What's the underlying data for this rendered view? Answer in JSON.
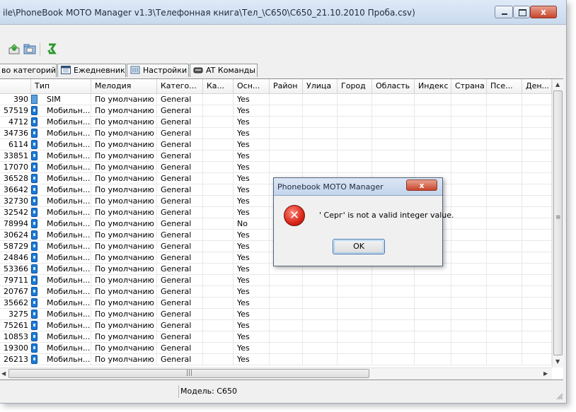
{
  "window": {
    "title": "ile\\PhoneBook MOTO Manager v1.3\\Телефонная книга\\Тел_\\C650\\C650_21.10.2010 Проба.csv)",
    "minimize_label": "",
    "maximize_label": "",
    "close_label": "x"
  },
  "toolbar": {
    "icons": [
      "export-icon",
      "folder-icon",
      "refresh-icon"
    ]
  },
  "tabs": [
    {
      "label": "во категорий",
      "icon": ""
    },
    {
      "label": "Ежедневник",
      "icon": "calendar-icon"
    },
    {
      "label": "Настройки",
      "icon": "settings-icon"
    },
    {
      "label": "AT Команды",
      "icon": "phone-icon"
    }
  ],
  "grid": {
    "headers": [
      "",
      "Тип",
      "Мелодия",
      "Катего...",
      "Ка...",
      "Осн...",
      "Район",
      "Улица",
      "Город",
      "Область",
      "Индекс",
      "Страна",
      "Псе...",
      "Ден..."
    ],
    "rows": [
      {
        "num": "390",
        "type": "SIM",
        "icon": "sim-icon",
        "melody": "По умолчанию",
        "category": "General",
        "main": "Yes"
      },
      {
        "num": "57519",
        "type": "Мобильн...",
        "icon": "mobile-icon",
        "melody": "По умолчанию",
        "category": "General",
        "main": "Yes"
      },
      {
        "num": "4712",
        "type": "Мобильн...",
        "icon": "mobile-icon",
        "melody": "По умолчанию",
        "category": "General",
        "main": "Yes"
      },
      {
        "num": "34736",
        "type": "Мобильн...",
        "icon": "mobile-icon",
        "melody": "По умолчанию",
        "category": "General",
        "main": "Yes"
      },
      {
        "num": "6114",
        "type": "Мобильн...",
        "icon": "mobile-icon",
        "melody": "По умолчанию",
        "category": "General",
        "main": "Yes"
      },
      {
        "num": "33851",
        "type": "Мобильн...",
        "icon": "mobile-icon",
        "melody": "По умолчанию",
        "category": "General",
        "main": "Yes"
      },
      {
        "num": "17070",
        "type": "Мобильн...",
        "icon": "mobile-icon",
        "melody": "По умолчанию",
        "category": "General",
        "main": "Yes"
      },
      {
        "num": "36528",
        "type": "Мобильн...",
        "icon": "mobile-icon",
        "melody": "По умолчанию",
        "category": "General",
        "main": "Yes"
      },
      {
        "num": "36642",
        "type": "Мобильн...",
        "icon": "mobile-icon",
        "melody": "По умолчанию",
        "category": "General",
        "main": "Yes"
      },
      {
        "num": "32730",
        "type": "Мобильн...",
        "icon": "mobile-icon",
        "melody": "По умолчанию",
        "category": "General",
        "main": "Yes"
      },
      {
        "num": "32542",
        "type": "Мобильн...",
        "icon": "mobile-icon",
        "melody": "По умолчанию",
        "category": "General",
        "main": "Yes"
      },
      {
        "num": "78994",
        "type": "Мобильн...",
        "icon": "mobile-icon",
        "melody": "По умолчанию",
        "category": "General",
        "main": "No"
      },
      {
        "num": "30624",
        "type": "Мобильн...",
        "icon": "mobile-icon",
        "melody": "По умолчанию",
        "category": "General",
        "main": "Yes"
      },
      {
        "num": "58729",
        "type": "Мобильн...",
        "icon": "mobile-icon",
        "melody": "По умолчанию",
        "category": "General",
        "main": "Yes"
      },
      {
        "num": "24846",
        "type": "Мобильн...",
        "icon": "mobile-icon",
        "melody": "По умолчанию",
        "category": "General",
        "main": "Yes"
      },
      {
        "num": "53366",
        "type": "Мобильн...",
        "icon": "mobile-icon",
        "melody": "По умолчанию",
        "category": "General",
        "main": "Yes"
      },
      {
        "num": "79711",
        "type": "Мобильн...",
        "icon": "mobile-icon",
        "melody": "По умолчанию",
        "category": "General",
        "main": "Yes"
      },
      {
        "num": "20767",
        "type": "Мобильн...",
        "icon": "mobile-icon",
        "melody": "По умолчанию",
        "category": "General",
        "main": "Yes"
      },
      {
        "num": "35662",
        "type": "Мобильн...",
        "icon": "mobile-icon",
        "melody": "По умолчанию",
        "category": "General",
        "main": "Yes"
      },
      {
        "num": "3275",
        "type": "Мобильн...",
        "icon": "mobile-icon",
        "melody": "По умолчанию",
        "category": "General",
        "main": "Yes"
      },
      {
        "num": "75261",
        "type": "Мобильн...",
        "icon": "mobile-icon",
        "melody": "По умолчанию",
        "category": "General",
        "main": "Yes"
      },
      {
        "num": "10853",
        "type": "Мобильн...",
        "icon": "mobile-icon",
        "melody": "По умолчанию",
        "category": "General",
        "main": "Yes"
      },
      {
        "num": "19300",
        "type": "Мобильн...",
        "icon": "mobile-icon",
        "melody": "По умолчанию",
        "category": "General",
        "main": "Yes"
      },
      {
        "num": "26213",
        "type": "Мобильн...",
        "icon": "mobile-icon",
        "melody": "По умолчанию",
        "category": "General",
        "main": "Yes"
      }
    ]
  },
  "statusbar": {
    "model": "Модель: C650"
  },
  "dialog": {
    "title": "Phonebook MOTO Manager",
    "close_label": "x",
    "icon": "error-icon",
    "message": "' Серг' is not a valid integer value.",
    "ok_label": "OK"
  },
  "colors": {
    "accent": "#3d74b8",
    "error": "#d8261a",
    "close_button": "#c8442b"
  }
}
